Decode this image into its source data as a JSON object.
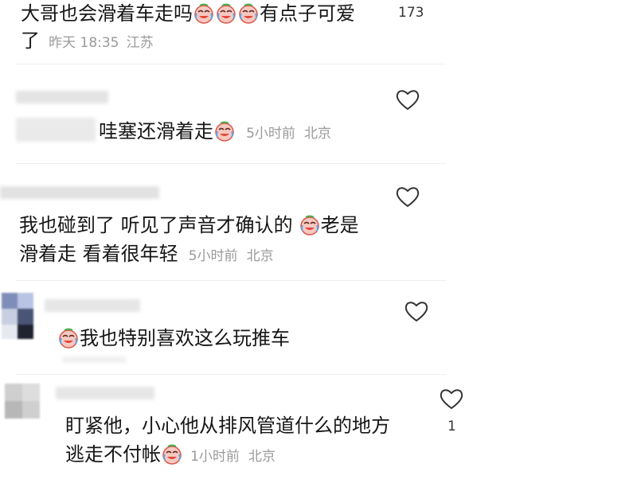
{
  "comments": [
    {
      "text_a": "大哥也会滑着车走吗",
      "text_b": "有点子可爱",
      "text_c": "了",
      "time": "昨天 18:35",
      "location": "江苏",
      "likes": "173"
    },
    {
      "text_a": "哇塞还滑着走",
      "time": "5小时前",
      "location": "北京"
    },
    {
      "text_a": "我也碰到了 听见了声音才确认的",
      "text_b": "老是",
      "text_c": "滑着走 看着很年轻",
      "time": "5小时前",
      "location": "北京"
    },
    {
      "text_a": "我也特别喜欢这么玩推车"
    },
    {
      "text_a": "盯紧他，小心他从排风管道什么的地方",
      "text_b": "逃走不付帐",
      "time": "1小时前",
      "location": "北京",
      "likes": "1"
    }
  ],
  "icons": {
    "like": "heart-outline-icon",
    "emoji": "crying-laughing-face-emoji"
  },
  "colors": {
    "text": "#161616",
    "meta": "#9a9a9a",
    "heart": "#333333"
  }
}
